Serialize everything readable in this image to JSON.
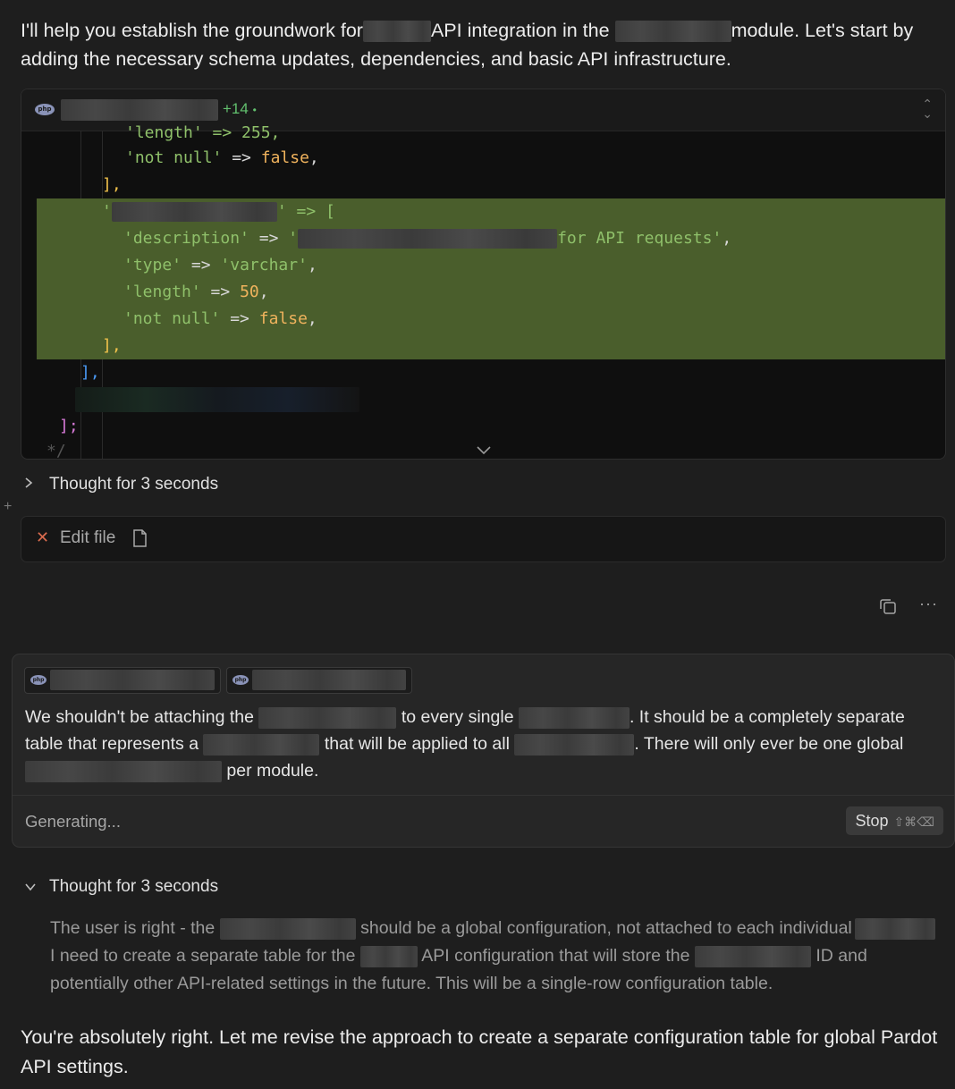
{
  "intro": {
    "p1": "I'll help you establish the groundwork for",
    "p2": "API integration in the",
    "p3": "module. Let's start by adding the necessary schema updates, dependencies, and basic API infrastructure."
  },
  "code_card": {
    "diff_count": "+14",
    "diff_dot": "•",
    "lines": {
      "l0": "'length' => 255,",
      "l1_a": "'not null'",
      "l1_b": " => ",
      "l1_c": "false",
      "l1_d": ",",
      "l2": "],",
      "l3_a": "'",
      "l3_b": "' => [",
      "l4_a": "'description'",
      "l4_b": " => ",
      "l4_c": "'",
      "l4_d": "for API requests'",
      "l4_e": ",",
      "l5_a": "'type'",
      "l5_b": " => ",
      "l5_c": "'varchar'",
      "l5_d": ",",
      "l6_a": "'length'",
      "l6_b": " => ",
      "l6_c": "50",
      "l6_d": ",",
      "l7_a": "'not null'",
      "l7_b": " => ",
      "l7_c": "false",
      "l7_d": ",",
      "l8": "],",
      "l9": "],",
      "l11": "];",
      "l12": "*/"
    }
  },
  "thought_collapsed": {
    "label": "Thought for 3 seconds"
  },
  "edit_file": {
    "label": "Edit file"
  },
  "user_message": {
    "t1": "We shouldn't be attaching the",
    "t2": "to every single",
    "t3": ". It should be a completely separate table that represents a",
    "t4": "that will be applied to all",
    "t5": ".  There will only ever be one global",
    "t6": "per module.",
    "status": "Generating...",
    "stop_label": "Stop",
    "stop_shortcut": "⇧⌘⌫"
  },
  "thought_expanded": {
    "label": "Thought for 3 seconds",
    "t1": "The user is right - the",
    "t2": "should be a global configuration, not attached to each individual",
    "t3": "I need to create a separate table for the",
    "t4": "API configuration that will store the",
    "t5": "ID and potentially other API-related settings in the future. This will be a single-row configuration table."
  },
  "outro": "You're absolutely right. Let me revise the approach to create a separate configuration table for global Pardot API settings.",
  "icons": {
    "file_type": "php-icon",
    "expand": "chevron-up-down-icon",
    "scroll_down": "chevron-down-icon",
    "collapsed": "chevron-right-icon",
    "expanded": "chevron-down-icon",
    "edit_status": "close-icon",
    "file": "file-icon",
    "copy": "copy-icon",
    "more": "ellipsis-icon"
  },
  "colors": {
    "background": "#1e1e1e",
    "diff_added_bg": "#4a5e2c",
    "diff_count": "#62c06e",
    "string": "#8fc06a",
    "number": "#f0b35d",
    "error_x": "#d86b4e"
  }
}
